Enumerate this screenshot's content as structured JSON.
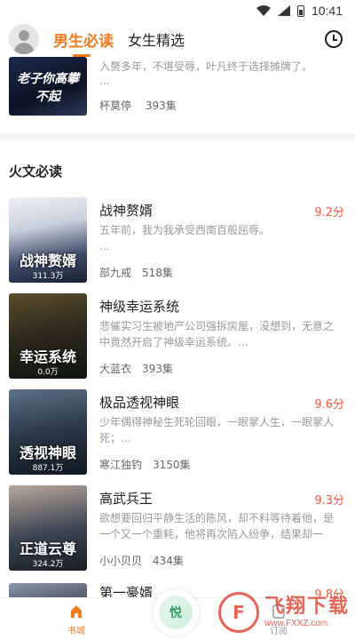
{
  "status_bar": {
    "time": "10:41"
  },
  "header": {
    "tabs": [
      {
        "label": "男生必读",
        "active": true
      },
      {
        "label": "女生精选",
        "active": false
      }
    ]
  },
  "partial_book": {
    "cover_text": "老子你高攀不起",
    "description": "入赘多年，不堪受辱，叶凡终于选择摊牌了。",
    "more": "...",
    "author": "杯莫停",
    "episodes": "393集"
  },
  "section": {
    "title": "火文必读"
  },
  "books": [
    {
      "title": "战神赘婿",
      "score": "9.2分",
      "description": "五年前，我为我承受西南百般屈辱。",
      "more": "...",
      "author": "部九戒",
      "episodes": "518集",
      "cover_title": "战神赘婿",
      "cover_count": "311.3万"
    },
    {
      "title": "神级幸运系统",
      "score": "",
      "description": "悲催实习生被地产公司强拆房屋，没想到，无意之中竟然开启了神级幸运系统。...",
      "author": "大蓝衣",
      "episodes": "393集",
      "cover_title": "幸运系统",
      "cover_count": "0.0万"
    },
    {
      "title": "极品透视神眼",
      "score": "9.6分",
      "description": "少年偶得神秘生死轮回眼，一眼掌人生，一眼掌人死；...",
      "author": "寒江独钓",
      "episodes": "3150集",
      "cover_title": "透视神眼",
      "cover_count": "887.1万"
    },
    {
      "title": "高武兵王",
      "score": "9.3分",
      "description": "欲想要回归平静生活的陈风，却不料等待着他，是一个又一个重耗，他将再次陷入纷争，结果却一次...",
      "author": "小小贝贝",
      "episodes": "434集",
      "cover_title": "正道云尊",
      "cover_count": "324.2万"
    }
  ],
  "last_book": {
    "title": "第一豪婿",
    "score": "9.8分"
  },
  "bottom_nav": {
    "items": [
      {
        "label": "书城",
        "active": true
      },
      {
        "label": "订阅",
        "active": false
      }
    ],
    "center_text": "悦"
  },
  "watermark": {
    "text": "飞翔下载",
    "url": "www.FXXZ.com"
  },
  "colors": {
    "accent": "#f07a1e",
    "score": "#ef5a3c"
  }
}
